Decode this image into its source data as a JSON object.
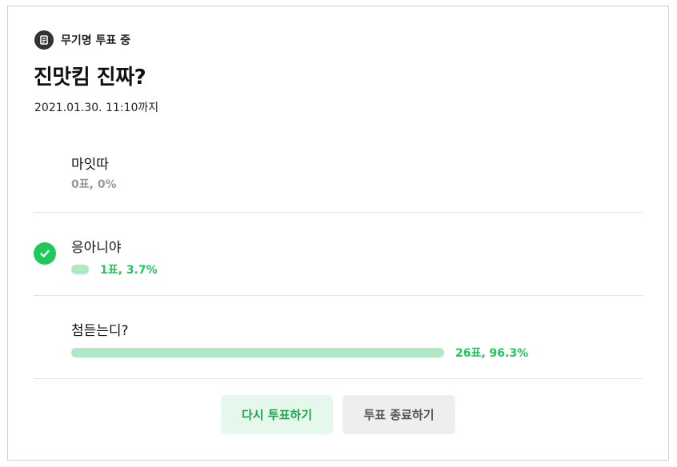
{
  "header": {
    "status": "무기명 투표 중",
    "icon": "poll-icon"
  },
  "poll": {
    "title": "진맛킴 진짜?",
    "deadline": "2021.01.30. 11:10까지"
  },
  "options": [
    {
      "label": "마잇따",
      "stat": "0표, 0%",
      "percent": 0,
      "selected": false
    },
    {
      "label": "응아니야",
      "stat": "1표, 3.7%",
      "percent": 3.7,
      "selected": true
    },
    {
      "label": "첨듣는디?",
      "stat": "26표, 96.3%",
      "percent": 96.3,
      "selected": false
    }
  ],
  "buttons": {
    "revote": "다시 투표하기",
    "end": "투표 종료하기"
  },
  "colors": {
    "accent": "#1ec85a",
    "bar": "#aee8c4",
    "revote_bg": "#e6f7ec",
    "end_bg": "#eeeeee"
  }
}
